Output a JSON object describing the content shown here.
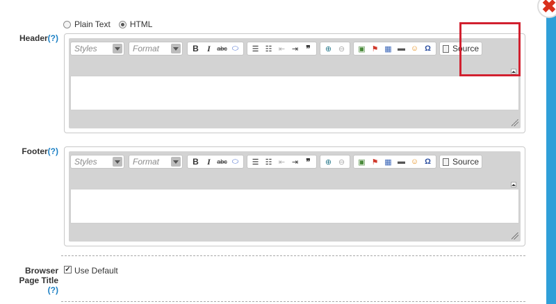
{
  "format": {
    "options": [
      "Plain Text",
      "HTML"
    ],
    "selected": "HTML"
  },
  "header_section": {
    "label": "Header",
    "help": "(?)"
  },
  "footer_section": {
    "label": "Footer",
    "help": "(?)"
  },
  "toolbar": {
    "styles_placeholder": "Styles",
    "format_placeholder": "Format",
    "bold": "B",
    "italic": "I",
    "strike": "abc",
    "source_label": "Source"
  },
  "icons": {
    "eraser": "⬭",
    "ordered_list": "☰",
    "bullet_list": "☷",
    "outdent": "⇤",
    "indent": "⇥",
    "blockquote": "❞",
    "link": "⊕",
    "unlink": "⊖",
    "image": "▣",
    "flash": "⚑",
    "table": "▦",
    "hr": "▬",
    "smiley": "☺",
    "omega": "Ω"
  },
  "browser_title": {
    "label_line1": "Browser",
    "label_line2": "Page Title",
    "help": "(?)",
    "checkbox_label": "Use Default",
    "checked": true
  },
  "close_glyph": "✖",
  "colors": {
    "accent": "#2f9fd8",
    "highlight": "#d1202f",
    "help": "#1a7fc4"
  }
}
